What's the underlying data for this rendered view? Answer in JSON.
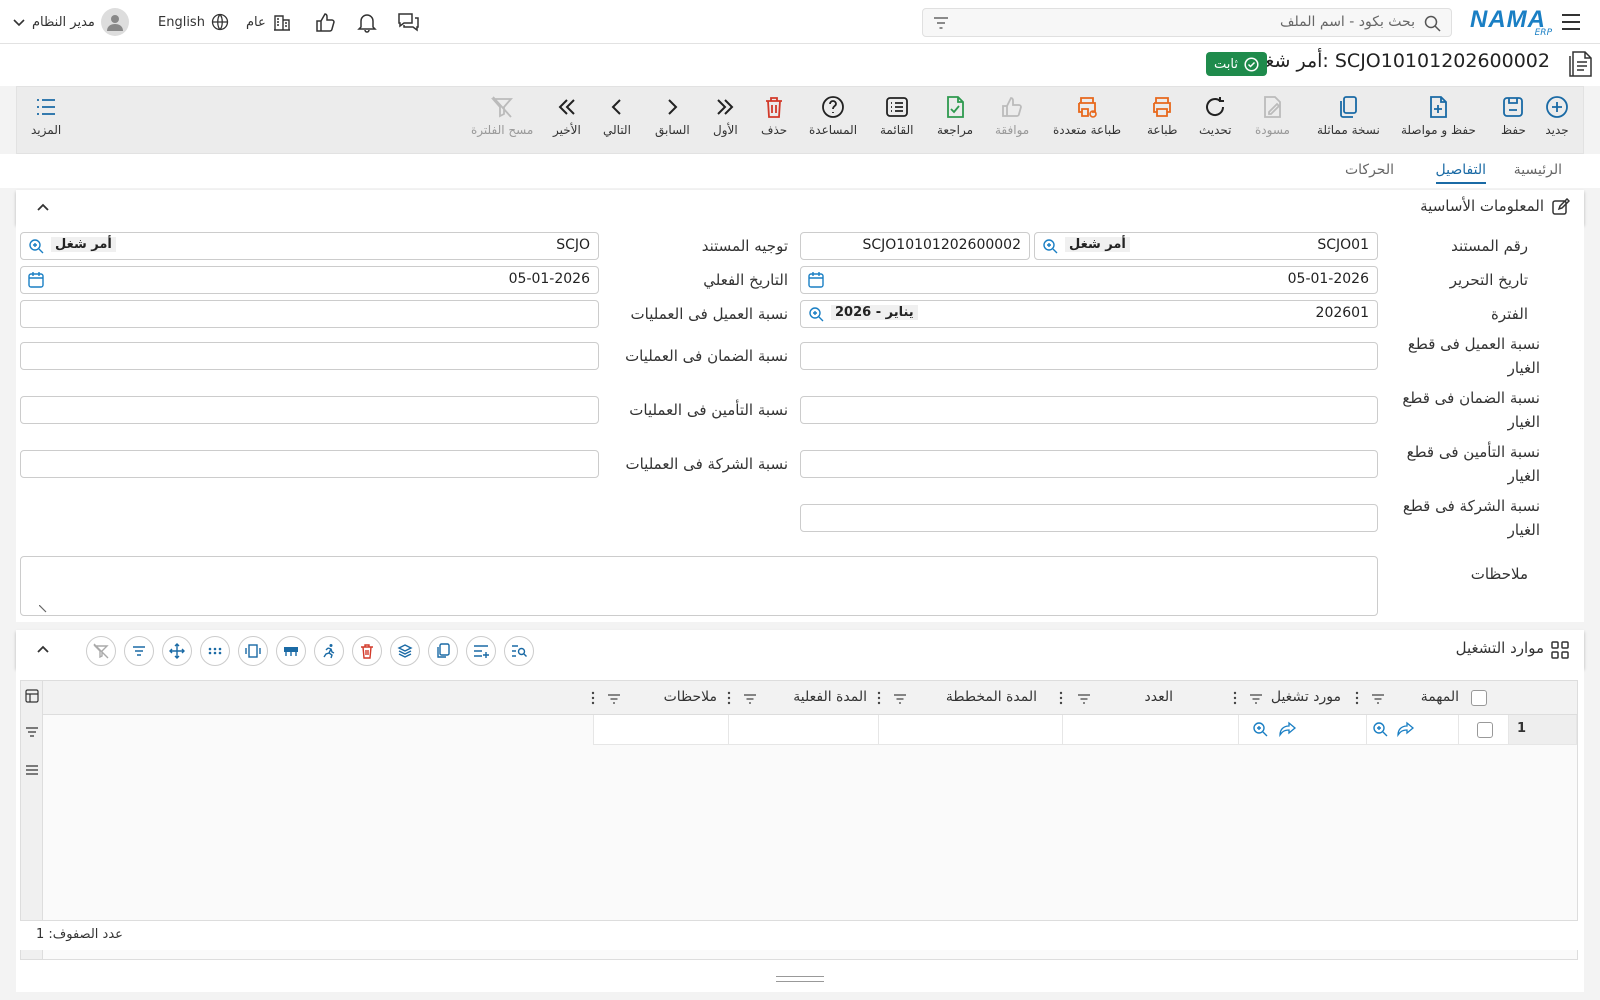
{
  "topbar": {
    "logo": "NAMA",
    "logo_sub": "ERP",
    "search_placeholder": "بحث بكود - اسم الملف",
    "user": "مدير النظام",
    "language": "English",
    "branch": "عام"
  },
  "title": {
    "text": "أمر شغل: SCJO10101202600002",
    "status": "ثابت"
  },
  "toolbar": {
    "new": "جديد",
    "save": "حفظ",
    "save_continue": "حفظ و مواصلة",
    "duplicate": "نسخة مماثلة",
    "draft": "مسودة",
    "refresh": "تحديث",
    "print": "طباعة",
    "multi_print": "طباعة متعددة",
    "approve": "موافقة",
    "review": "مراجعة",
    "list": "القائمة",
    "help": "المساعدة",
    "delete": "حذف",
    "first": "الأول",
    "previous": "السابق",
    "next": "التالي",
    "last": "الأخير",
    "clear_filter": "مسح الفلترة",
    "more": "المزيد"
  },
  "tabs": [
    "الرئيسية",
    "التفاصيل",
    "الحركات"
  ],
  "basic_info": {
    "section_title": "المعلومات الأساسية",
    "doc_number_label": "رقم المستند",
    "doc_number_book": "SCJO01",
    "doc_number_book_tag": "أمر شغل",
    "doc_number_value": "SCJO10101202600002",
    "doc_direction_label": "توجيه المستند",
    "doc_direction_value": "SCJO",
    "doc_direction_tag": "أمر شغل",
    "edit_date_label": "تاريخ التحرير",
    "edit_date_value": "05-01-2026",
    "actual_date_label": "التاريخ الفعلي",
    "actual_date_value": "05-01-2026",
    "period_label": "الفترة",
    "period_value": "202601",
    "period_tag": "2026 - يناير",
    "customer_ops_label": "نسبة العميل فى العمليات",
    "customer_parts_label": "نسبة العميل فى قطع الغيار",
    "warranty_ops_label": "نسبة الضمان فى العمليات",
    "warranty_parts_label": "نسبة الضمان فى قطع الغيار",
    "insurance_ops_label": "نسبة التأمين فى العمليات",
    "insurance_parts_label": "نسبة التأمين فى قطع الغيار",
    "company_ops_label": "نسبة الشركة فى العمليات",
    "company_parts_label": "نسبة الشركة فى قطع الغيار",
    "notes_label": "ملاحظات"
  },
  "resources": {
    "section_title": "موارد التشغيل",
    "columns": [
      "المهمة",
      "مورد تشغيل",
      "العدد",
      "المدة المخططة",
      "المدة الفعلية",
      "ملاحظات"
    ],
    "row_number": "1",
    "row_count": "عدد الصفوف: 1"
  }
}
